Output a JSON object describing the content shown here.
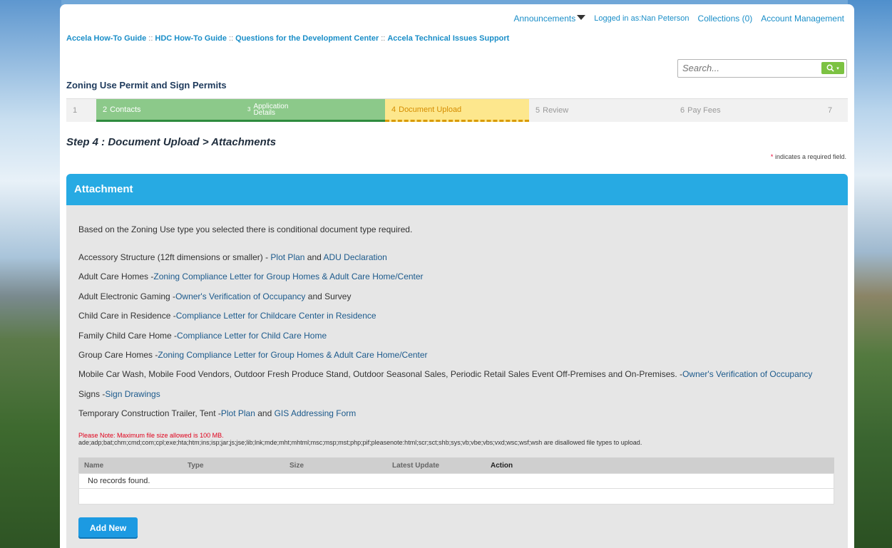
{
  "topnav": {
    "announcements": "Announcements",
    "logged_in": "Logged in as:Nan Peterson",
    "collections": "Collections (0)",
    "account": "Account Management"
  },
  "breadcrumbs": [
    "Accela How-To Guide",
    "HDC How-To Guide",
    "Questions for the Development Center",
    "Accela Technical Issues Support"
  ],
  "breadcrumb_sep": "::",
  "search": {
    "placeholder": "Search..."
  },
  "page_title": "Zoning Use Permit and Sign Permits",
  "steps": [
    {
      "num": "1",
      "label": "",
      "state": "plain"
    },
    {
      "num": "2",
      "label": "Contacts",
      "state": "done"
    },
    {
      "num": "3",
      "label": "Application Details",
      "state": "done"
    },
    {
      "num": "4",
      "label": "Document Upload",
      "state": "active"
    },
    {
      "num": "5",
      "label": "Review",
      "state": "plain"
    },
    {
      "num": "6",
      "label": "Pay Fees",
      "state": "plain"
    },
    {
      "num": "7",
      "label": "",
      "state": "plain"
    }
  ],
  "step_heading": "Step 4 : Document Upload > Attachments",
  "required_note": {
    "star": "*",
    "text": " indicates a required field."
  },
  "panel": {
    "title": "Attachment",
    "intro": "Based on the Zoning Use type you selected there is conditional document type required.",
    "rules": [
      {
        "label": "Accessory Structure (12ft dimensions or smaller) - ",
        "links": [
          "Plot Plan",
          "ADU Declaration"
        ],
        "joiner": " and ",
        "suffix": ""
      },
      {
        "label": "Adult Care Homes -",
        "links": [
          "Zoning Compliance Letter for Group Homes & Adult Care Home/Center"
        ],
        "joiner": "",
        "suffix": ""
      },
      {
        "label": "Adult Electronic Gaming -",
        "links": [
          "Owner's Verification of Occupancy"
        ],
        "joiner": "",
        "suffix": " and Survey"
      },
      {
        "label": "Child Care in Residence -",
        "links": [
          "Compliance Letter for Childcare Center in Residence"
        ],
        "joiner": "",
        "suffix": ""
      },
      {
        "label": "Family Child Care Home -",
        "links": [
          "Compliance Letter for Child Care Home"
        ],
        "joiner": "",
        "suffix": ""
      },
      {
        "label": "Group Care Homes -",
        "links": [
          "Zoning Compliance Letter for Group Homes & Adult Care Home/Center"
        ],
        "joiner": "",
        "suffix": ""
      },
      {
        "label": "Mobile Car Wash, Mobile Food Vendors, Outdoor Fresh Produce Stand, Outdoor Seasonal Sales, Periodic Retail Sales Event Off-Premises and On-Premises. -",
        "links": [
          "Owner's Verification of Occupancy"
        ],
        "joiner": "",
        "suffix": ""
      },
      {
        "label": "Signs -",
        "links": [
          "Sign Drawings"
        ],
        "joiner": "",
        "suffix": ""
      },
      {
        "label": "Temporary Construction Trailer, Tent -",
        "links": [
          "Plot Plan",
          "GIS Addressing Form"
        ],
        "joiner": " and ",
        "suffix": ""
      }
    ],
    "note_red": "Please Note: Maximum file size allowed is 100 MB.",
    "disallowed": "ade;adp;bat;chm;cmd;com;cpl;exe;hta;htm;ins;isp;jar;js;jse;lib;lnk;mde;mht;mhtml;msc;msp;mst;php;pif;pleasenote:html;scr;sct;shb;sys;vb;vbe;vbs;vxd;wsc;wsf;wsh are disallowed file types to upload.",
    "table": {
      "headers": [
        "Name",
        "Type",
        "Size",
        "Latest Update",
        "Action"
      ],
      "empty": "No records found."
    },
    "add_button": "Add New"
  },
  "colors": {
    "accent": "#27aae3",
    "done": "#8cc98a",
    "active": "#fde78d",
    "search_btn": "#7cc242"
  }
}
